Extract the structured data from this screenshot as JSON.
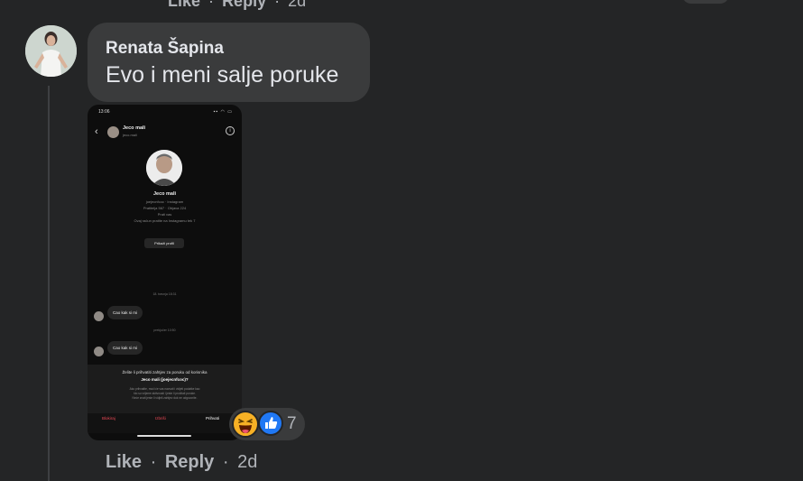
{
  "previous_comment": {
    "like_label": "Like",
    "reply_label": "Reply",
    "separator": "·",
    "time": "2d"
  },
  "comment": {
    "author": "Renata Šapina",
    "text": "Evo i meni salje poruke",
    "avatar_icon": "profile-photo",
    "actions": {
      "like_label": "Like",
      "reply_label": "Reply",
      "separator": "·",
      "time": "2d"
    },
    "reactions": {
      "icons": [
        "haha-icon",
        "like-icon"
      ],
      "count": "7"
    }
  },
  "attachment": {
    "status_time": "13:06",
    "status_icons": "▪▪ ◠ ▭",
    "back_glyph": "‹",
    "info_glyph": "i",
    "header_name": "Jeco mali",
    "header_username": "jeco.mali",
    "profile_name": "Jeco mali",
    "profile_line1": "joejecnfcoc · Instagram",
    "profile_line2": "Pratitelja 567 · Objava 224",
    "profile_line3": "Prati vas",
    "profile_line4": "Ovaj račun pratite na Instagramu tek 7",
    "profile_button": "Prikaži profil",
    "date1": "18. travnja 18:31",
    "msg1": "Cao kak si mi",
    "date2": "prekjučer 10:50",
    "msg2": "Cao kak si mi",
    "request_line1": "Želite li prihvatiti zahtjev za poruku od korisnika",
    "request_line2": "Jeco mali (joejecnfcoc)?",
    "small_line1": "Ako prihvatite, moći će vas nazvati i vidjeti podatke kao",
    "small_line2": "što su vrijeme aktivnosti i jeste li pročitali poruke.",
    "small_line3": "Neće znati jeste li vidjeli zahtjev dok ne odgovorite.",
    "block_label": "Blokiraj",
    "delete_label": "Izbriši",
    "accept_label": "Prihvati"
  },
  "colors": {
    "background": "#242526",
    "bubble": "#3a3b3c",
    "text_primary": "#e4e6eb",
    "text_secondary": "#b0b3b8",
    "like_blue": "#2078f4",
    "haha_yellow": "#f7b125",
    "instagram_red": "#ed4956"
  }
}
